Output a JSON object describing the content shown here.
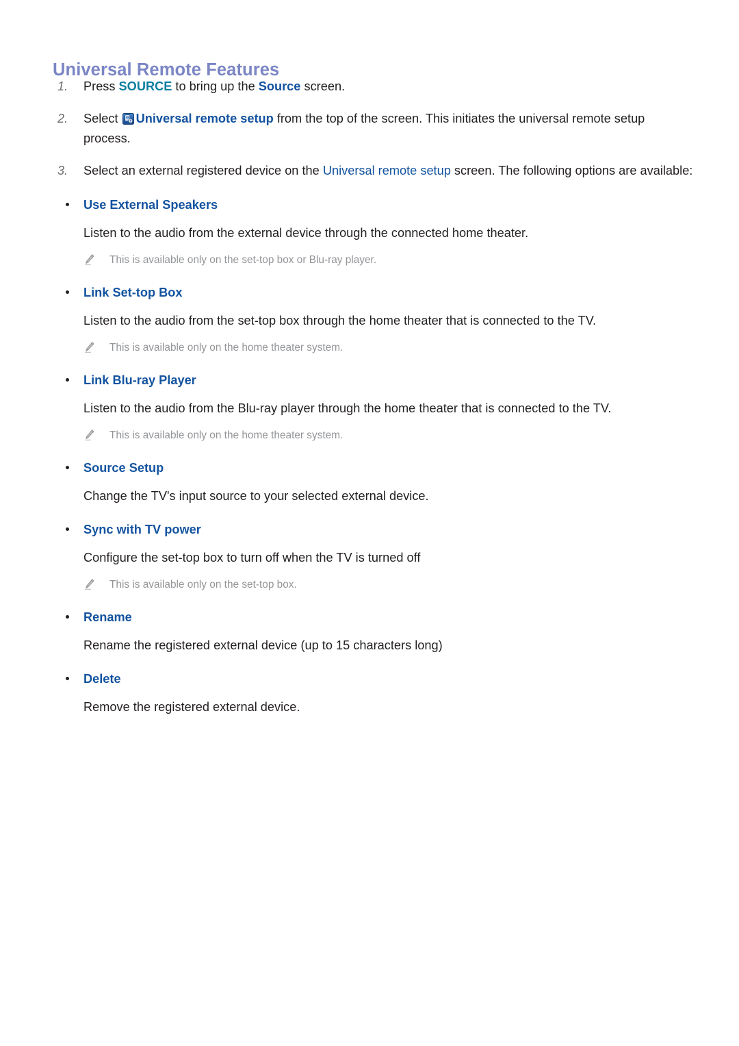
{
  "document": {
    "title": "Universal Remote Features",
    "title_color": "#7b86c4",
    "accent_blue": "#13539f",
    "accent_teal": "#0d7e9f",
    "note_gray": "#939598",
    "body_color": "#231f20",
    "background": "#ffffff"
  },
  "steps": [
    {
      "num": "1.",
      "parts": [
        {
          "text": "Press ",
          "style": "plain"
        },
        {
          "text": "SOURCE",
          "style": "teal-bold"
        },
        {
          "text": " to bring up the ",
          "style": "plain"
        },
        {
          "text": "Source",
          "style": "blue-bold"
        },
        {
          "text": " screen.",
          "style": "plain"
        }
      ],
      "plain_text": "Press SOURCE to bring up the Source screen."
    },
    {
      "num": "2.",
      "icon": "universal-remote-setup-icon",
      "parts": [
        {
          "text": "Select ",
          "style": "plain"
        },
        {
          "text": "ICON",
          "style": "icon"
        },
        {
          "text": "Universal remote setup",
          "style": "blue-bold"
        },
        {
          "text": " from the top of the screen. This initiates the universal remote setup process.",
          "style": "plain"
        }
      ],
      "plain_text": "Select Universal remote setup from the top of the screen. This initiates the universal remote setup process."
    },
    {
      "num": "3.",
      "parts": [
        {
          "text": "Select an external registered device on the ",
          "style": "plain"
        },
        {
          "text": "Universal remote setup",
          "style": "blue-reg"
        },
        {
          "text": " screen. The following options are available:",
          "style": "plain"
        }
      ],
      "plain_text": "Select an external registered device on the Universal remote setup screen. The following options are available:"
    }
  ],
  "options": [
    {
      "heading": "Use External Speakers",
      "description": "Listen to the audio from the external device through the connected home theater.",
      "note": "This is available only on the set-top box or Blu-ray player."
    },
    {
      "heading": "Link Set-top Box",
      "description": "Listen to the audio from the set-top box through the home theater that is connected to the TV.",
      "note": "This is available only on the home theater system."
    },
    {
      "heading": "Link Blu-ray Player",
      "description": "Listen to the audio from the Blu-ray player through the home theater that is connected to the TV.",
      "note": "This is available only on the home theater system."
    },
    {
      "heading": "Source Setup",
      "description": "Change the TV's input source to your selected external device.",
      "note": null
    },
    {
      "heading": "Sync with TV power",
      "description": "Configure the set-top box to turn off when the TV is turned off",
      "note": "This is available only on the set-top box."
    },
    {
      "heading": "Rename",
      "description": "Rename the registered external device (up to 15 characters long)",
      "note": null
    },
    {
      "heading": "Delete",
      "description": "Remove the registered external device.",
      "note": null
    }
  ],
  "icons": {
    "note_icon_name": "pencil-icon",
    "inline_icon_name": "universal-remote-setup-icon"
  }
}
